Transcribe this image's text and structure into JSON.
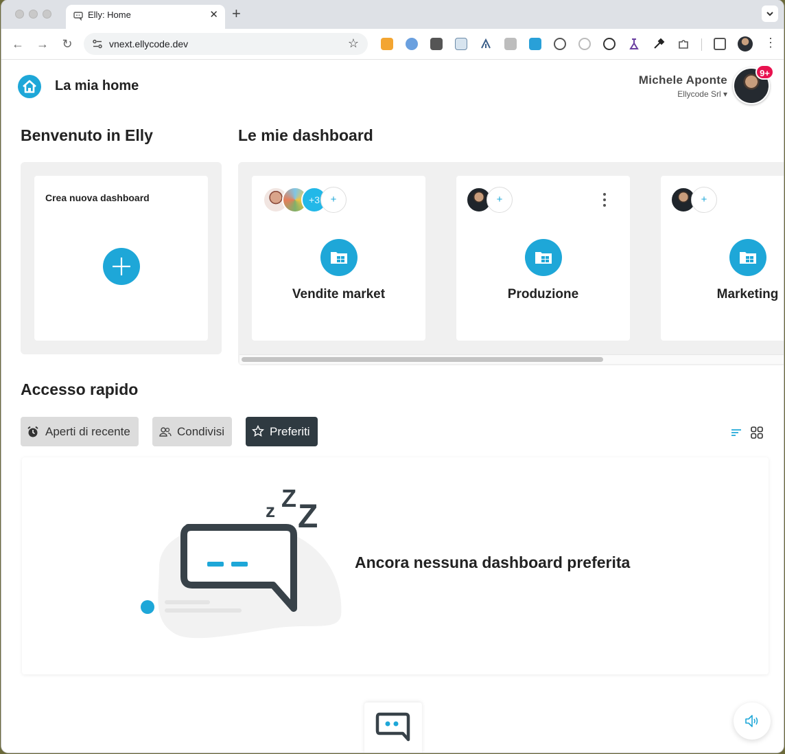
{
  "browser": {
    "tab_title": "Elly: Home",
    "tab_close": "✕",
    "new_tab": "+",
    "url": "vnext.ellycode.dev",
    "colors": {
      "tabstrip": "#dee1e6",
      "omnibox": "#f1f3f4"
    }
  },
  "header": {
    "title": "La mia home",
    "user_name": "Michele Aponte",
    "company": "Ellycode Srl ▾",
    "notifications": "9+"
  },
  "welcome": {
    "title": "Benvenuto in Elly",
    "new_dashboard_label": "Crea nuova dashboard"
  },
  "dashboards": {
    "title": "Le mie dashboard",
    "items": [
      {
        "name": "Vendite market",
        "extra_members": "+3"
      },
      {
        "name": "Produzione"
      },
      {
        "name": "Marketing"
      }
    ]
  },
  "quick_access": {
    "title": "Accesso rapido",
    "tabs": [
      {
        "label": "Aperti di recente",
        "icon": "alarm-clock-icon"
      },
      {
        "label": "Condivisi",
        "icon": "users-icon"
      },
      {
        "label": "Preferiti",
        "icon": "star-icon",
        "active": true
      }
    ],
    "empty_message": "Ancora nessuna dashboard preferita"
  },
  "colors": {
    "accent": "#1ea7d8",
    "dark": "#2f3a41",
    "badge": "#e8124f",
    "panel": "#f0f0f0"
  }
}
